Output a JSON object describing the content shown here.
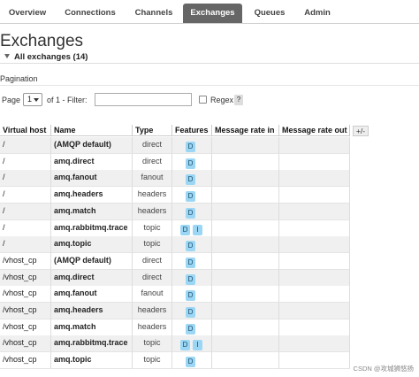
{
  "nav": {
    "tabs": [
      {
        "label": "Overview",
        "active": false
      },
      {
        "label": "Connections",
        "active": false
      },
      {
        "label": "Channels",
        "active": false
      },
      {
        "label": "Exchanges",
        "active": true
      },
      {
        "label": "Queues",
        "active": false
      },
      {
        "label": "Admin",
        "active": false
      }
    ]
  },
  "page": {
    "title": "Exchanges",
    "section_label": "All exchanges (14)"
  },
  "pagination": {
    "title": "Pagination",
    "page_label": "Page",
    "page_value": "1",
    "of_label": "of 1  - Filter:",
    "filter_value": "",
    "regex_label": "Regex",
    "help_label": "?"
  },
  "table": {
    "headers": [
      "Virtual host",
      "Name",
      "Type",
      "Features",
      "Message rate in",
      "Message rate out"
    ],
    "column_toggle": "+/-",
    "rows": [
      {
        "vhost": "/",
        "name": "(AMQP default)",
        "type": "direct",
        "features": [
          "D"
        ]
      },
      {
        "vhost": "/",
        "name": "amq.direct",
        "type": "direct",
        "features": [
          "D"
        ]
      },
      {
        "vhost": "/",
        "name": "amq.fanout",
        "type": "fanout",
        "features": [
          "D"
        ]
      },
      {
        "vhost": "/",
        "name": "amq.headers",
        "type": "headers",
        "features": [
          "D"
        ]
      },
      {
        "vhost": "/",
        "name": "amq.match",
        "type": "headers",
        "features": [
          "D"
        ]
      },
      {
        "vhost": "/",
        "name": "amq.rabbitmq.trace",
        "type": "topic",
        "features": [
          "D",
          "I"
        ]
      },
      {
        "vhost": "/",
        "name": "amq.topic",
        "type": "topic",
        "features": [
          "D"
        ]
      },
      {
        "vhost": "/vhost_cp",
        "name": "(AMQP default)",
        "type": "direct",
        "features": [
          "D"
        ]
      },
      {
        "vhost": "/vhost_cp",
        "name": "amq.direct",
        "type": "direct",
        "features": [
          "D"
        ]
      },
      {
        "vhost": "/vhost_cp",
        "name": "amq.fanout",
        "type": "fanout",
        "features": [
          "D"
        ]
      },
      {
        "vhost": "/vhost_cp",
        "name": "amq.headers",
        "type": "headers",
        "features": [
          "D"
        ]
      },
      {
        "vhost": "/vhost_cp",
        "name": "amq.match",
        "type": "headers",
        "features": [
          "D"
        ]
      },
      {
        "vhost": "/vhost_cp",
        "name": "amq.rabbitmq.trace",
        "type": "topic",
        "features": [
          "D",
          "I"
        ]
      },
      {
        "vhost": "/vhost_cp",
        "name": "amq.topic",
        "type": "topic",
        "features": [
          "D"
        ]
      }
    ]
  },
  "watermark": "CSDN @攻城狮悠扬",
  "colors": {
    "active_tab": "#666666",
    "feature_badge": "#9bd7f5"
  }
}
